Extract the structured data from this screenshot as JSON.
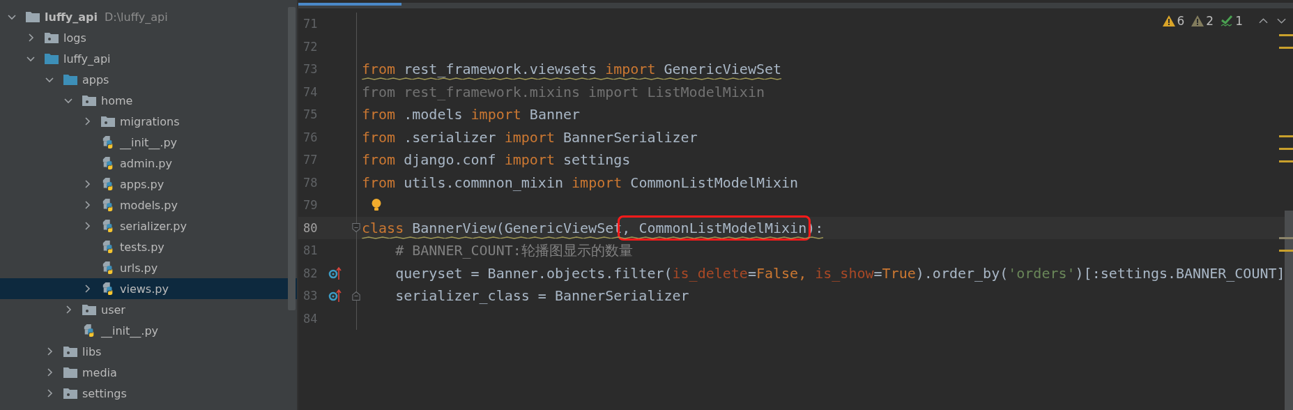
{
  "project_tree": {
    "items": [
      {
        "label": "luffy_api",
        "hint": "D:\\luffy_api",
        "kind": "folder",
        "expanded": true,
        "selected": false,
        "children": [
          {
            "label": "logs",
            "kind": "package",
            "expanded": false,
            "selected": false
          },
          {
            "label": "luffy_api",
            "kind": "source",
            "expanded": true,
            "selected": false,
            "children": [
              {
                "label": "apps",
                "kind": "source",
                "expanded": true,
                "selected": false,
                "children": [
                  {
                    "label": "home",
                    "kind": "package",
                    "expanded": true,
                    "selected": false,
                    "children": [
                      {
                        "label": "migrations",
                        "kind": "package",
                        "expanded": false,
                        "selected": false
                      },
                      {
                        "label": "__init__.py",
                        "kind": "python",
                        "selected": false
                      },
                      {
                        "label": "admin.py",
                        "kind": "python",
                        "selected": false
                      },
                      {
                        "label": "apps.py",
                        "kind": "python",
                        "expanded": false,
                        "selected": false
                      },
                      {
                        "label": "models.py",
                        "kind": "python",
                        "expanded": false,
                        "selected": false
                      },
                      {
                        "label": "serializer.py",
                        "kind": "python",
                        "expanded": false,
                        "selected": false
                      },
                      {
                        "label": "tests.py",
                        "kind": "python",
                        "selected": false
                      },
                      {
                        "label": "urls.py",
                        "kind": "python",
                        "selected": false
                      },
                      {
                        "label": "views.py",
                        "kind": "python",
                        "expanded": false,
                        "selected": true
                      }
                    ]
                  },
                  {
                    "label": "user",
                    "kind": "package",
                    "expanded": false,
                    "selected": false
                  },
                  {
                    "label": "__init__.py",
                    "kind": "python",
                    "selected": false
                  }
                ]
              },
              {
                "label": "libs",
                "kind": "package",
                "expanded": false,
                "selected": false
              },
              {
                "label": "media",
                "kind": "folder",
                "expanded": false,
                "selected": false
              },
              {
                "label": "settings",
                "kind": "package",
                "expanded": false,
                "selected": false
              }
            ]
          }
        ]
      }
    ]
  },
  "inspections": [
    {
      "kind": "warning",
      "count": "6"
    },
    {
      "kind": "weak_warning",
      "count": "2"
    },
    {
      "kind": "typo",
      "count": "1"
    }
  ],
  "lines": [
    {
      "number": "71",
      "current": false
    },
    {
      "number": "72",
      "current": false
    },
    {
      "number": "73",
      "current": false,
      "squiggle": true,
      "tokens": [
        {
          "text": "from",
          "kind": "keyword"
        },
        {
          "text": " rest_framework.viewsets ",
          "kind": "plain"
        },
        {
          "text": "import",
          "kind": "keyword"
        },
        {
          "text": " GenericViewSet",
          "kind": "plain"
        }
      ]
    },
    {
      "number": "74",
      "current": false,
      "squiggle": false,
      "tokens": [
        {
          "text": "from rest_framework.mixins import ListModelMixin",
          "kind": "unused"
        }
      ]
    },
    {
      "number": "75",
      "current": false,
      "squiggle": false,
      "tokens": [
        {
          "text": "from",
          "kind": "keyword"
        },
        {
          "text": " .models ",
          "kind": "plain"
        },
        {
          "text": "import",
          "kind": "keyword"
        },
        {
          "text": " Banner",
          "kind": "plain"
        }
      ]
    },
    {
      "number": "76",
      "current": false,
      "squiggle": false,
      "tokens": [
        {
          "text": "from",
          "kind": "keyword"
        },
        {
          "text": " .serializer ",
          "kind": "plain"
        },
        {
          "text": "import",
          "kind": "keyword"
        },
        {
          "text": " BannerSerializer",
          "kind": "plain"
        }
      ]
    },
    {
      "number": "77",
      "current": false,
      "squiggle": false,
      "tokens": [
        {
          "text": "from",
          "kind": "keyword"
        },
        {
          "text": " django.conf ",
          "kind": "plain"
        },
        {
          "text": "import",
          "kind": "keyword"
        },
        {
          "text": " settings",
          "kind": "plain"
        }
      ]
    },
    {
      "number": "78",
      "current": false,
      "squiggle": false,
      "tokens": [
        {
          "text": "from",
          "kind": "keyword"
        },
        {
          "text": " utils.commnon_mixin ",
          "kind": "plain"
        },
        {
          "text": "import",
          "kind": "keyword"
        },
        {
          "text": " CommonListModelMixin",
          "kind": "plain"
        }
      ]
    },
    {
      "number": "79",
      "current": false,
      "bulb": true
    },
    {
      "number": "80",
      "current": true,
      "squiggle": true,
      "fold_start": true,
      "tokens": [
        {
          "text": "class",
          "kind": "keyword"
        },
        {
          "text": " BannerView(GenericViewSet",
          "kind": "plain"
        },
        {
          "text": ", CommonListModelMixin",
          "kind": "plain",
          "boxed": true
        },
        {
          "text": "):",
          "kind": "plain"
        }
      ]
    },
    {
      "number": "81",
      "current": false,
      "squiggle": false,
      "tokens": [
        {
          "text": "    # BANNER_COUNT:轮播图显示的数量",
          "kind": "comment"
        }
      ]
    },
    {
      "number": "82",
      "current": false,
      "squiggle": false,
      "overrides": true,
      "tokens": [
        {
          "text": "    queryset = Banner.objects.filter(",
          "kind": "plain"
        },
        {
          "text": "is_delete",
          "kind": "param"
        },
        {
          "text": "=",
          "kind": "plain"
        },
        {
          "text": "False, ",
          "kind": "keyword"
        },
        {
          "text": "is_show",
          "kind": "param"
        },
        {
          "text": "=",
          "kind": "plain"
        },
        {
          "text": "True",
          "kind": "keyword"
        },
        {
          "text": ").order_by(",
          "kind": "plain"
        },
        {
          "text": "'orders'",
          "kind": "string"
        },
        {
          "text": ")[:settings.BANNER_COUNT]",
          "kind": "plain"
        }
      ]
    },
    {
      "number": "83",
      "current": false,
      "squiggle": false,
      "overrides": true,
      "fold_end": true,
      "tokens": [
        {
          "text": "    serializer_class = BannerSerializer",
          "kind": "plain"
        }
      ]
    },
    {
      "number": "84",
      "current": false
    }
  ]
}
